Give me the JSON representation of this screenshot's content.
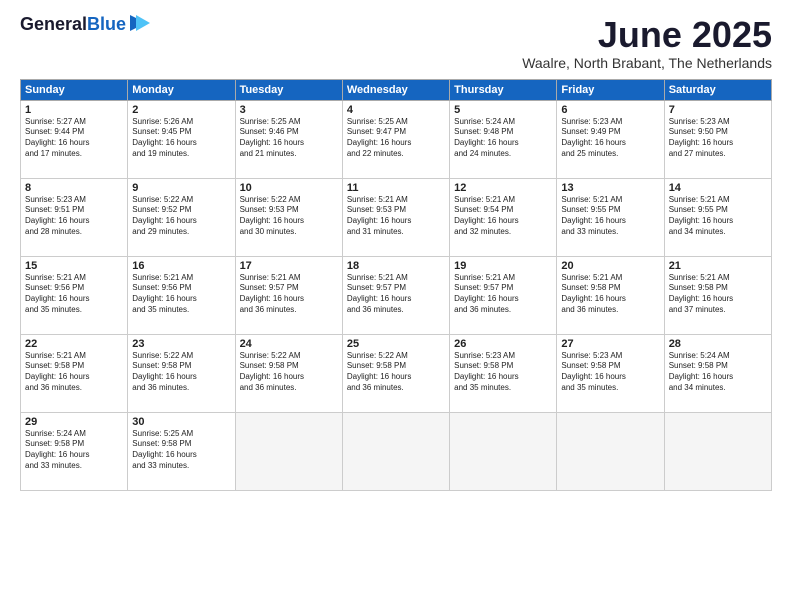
{
  "logo": {
    "line1": "General",
    "line2": "Blue"
  },
  "title": "June 2025",
  "subtitle": "Waalre, North Brabant, The Netherlands",
  "days_of_week": [
    "Sunday",
    "Monday",
    "Tuesday",
    "Wednesday",
    "Thursday",
    "Friday",
    "Saturday"
  ],
  "weeks": [
    [
      {
        "day": 1,
        "lines": [
          "Sunrise: 5:27 AM",
          "Sunset: 9:44 PM",
          "Daylight: 16 hours",
          "and 17 minutes."
        ]
      },
      {
        "day": 2,
        "lines": [
          "Sunrise: 5:26 AM",
          "Sunset: 9:45 PM",
          "Daylight: 16 hours",
          "and 19 minutes."
        ]
      },
      {
        "day": 3,
        "lines": [
          "Sunrise: 5:25 AM",
          "Sunset: 9:46 PM",
          "Daylight: 16 hours",
          "and 21 minutes."
        ]
      },
      {
        "day": 4,
        "lines": [
          "Sunrise: 5:25 AM",
          "Sunset: 9:47 PM",
          "Daylight: 16 hours",
          "and 22 minutes."
        ]
      },
      {
        "day": 5,
        "lines": [
          "Sunrise: 5:24 AM",
          "Sunset: 9:48 PM",
          "Daylight: 16 hours",
          "and 24 minutes."
        ]
      },
      {
        "day": 6,
        "lines": [
          "Sunrise: 5:23 AM",
          "Sunset: 9:49 PM",
          "Daylight: 16 hours",
          "and 25 minutes."
        ]
      },
      {
        "day": 7,
        "lines": [
          "Sunrise: 5:23 AM",
          "Sunset: 9:50 PM",
          "Daylight: 16 hours",
          "and 27 minutes."
        ]
      }
    ],
    [
      {
        "day": 8,
        "lines": [
          "Sunrise: 5:23 AM",
          "Sunset: 9:51 PM",
          "Daylight: 16 hours",
          "and 28 minutes."
        ]
      },
      {
        "day": 9,
        "lines": [
          "Sunrise: 5:22 AM",
          "Sunset: 9:52 PM",
          "Daylight: 16 hours",
          "and 29 minutes."
        ]
      },
      {
        "day": 10,
        "lines": [
          "Sunrise: 5:22 AM",
          "Sunset: 9:53 PM",
          "Daylight: 16 hours",
          "and 30 minutes."
        ]
      },
      {
        "day": 11,
        "lines": [
          "Sunrise: 5:21 AM",
          "Sunset: 9:53 PM",
          "Daylight: 16 hours",
          "and 31 minutes."
        ]
      },
      {
        "day": 12,
        "lines": [
          "Sunrise: 5:21 AM",
          "Sunset: 9:54 PM",
          "Daylight: 16 hours",
          "and 32 minutes."
        ]
      },
      {
        "day": 13,
        "lines": [
          "Sunrise: 5:21 AM",
          "Sunset: 9:55 PM",
          "Daylight: 16 hours",
          "and 33 minutes."
        ]
      },
      {
        "day": 14,
        "lines": [
          "Sunrise: 5:21 AM",
          "Sunset: 9:55 PM",
          "Daylight: 16 hours",
          "and 34 minutes."
        ]
      }
    ],
    [
      {
        "day": 15,
        "lines": [
          "Sunrise: 5:21 AM",
          "Sunset: 9:56 PM",
          "Daylight: 16 hours",
          "and 35 minutes."
        ]
      },
      {
        "day": 16,
        "lines": [
          "Sunrise: 5:21 AM",
          "Sunset: 9:56 PM",
          "Daylight: 16 hours",
          "and 35 minutes."
        ]
      },
      {
        "day": 17,
        "lines": [
          "Sunrise: 5:21 AM",
          "Sunset: 9:57 PM",
          "Daylight: 16 hours",
          "and 36 minutes."
        ]
      },
      {
        "day": 18,
        "lines": [
          "Sunrise: 5:21 AM",
          "Sunset: 9:57 PM",
          "Daylight: 16 hours",
          "and 36 minutes."
        ]
      },
      {
        "day": 19,
        "lines": [
          "Sunrise: 5:21 AM",
          "Sunset: 9:57 PM",
          "Daylight: 16 hours",
          "and 36 minutes."
        ]
      },
      {
        "day": 20,
        "lines": [
          "Sunrise: 5:21 AM",
          "Sunset: 9:58 PM",
          "Daylight: 16 hours",
          "and 36 minutes."
        ]
      },
      {
        "day": 21,
        "lines": [
          "Sunrise: 5:21 AM",
          "Sunset: 9:58 PM",
          "Daylight: 16 hours",
          "and 37 minutes."
        ]
      }
    ],
    [
      {
        "day": 22,
        "lines": [
          "Sunrise: 5:21 AM",
          "Sunset: 9:58 PM",
          "Daylight: 16 hours",
          "and 36 minutes."
        ]
      },
      {
        "day": 23,
        "lines": [
          "Sunrise: 5:22 AM",
          "Sunset: 9:58 PM",
          "Daylight: 16 hours",
          "and 36 minutes."
        ]
      },
      {
        "day": 24,
        "lines": [
          "Sunrise: 5:22 AM",
          "Sunset: 9:58 PM",
          "Daylight: 16 hours",
          "and 36 minutes."
        ]
      },
      {
        "day": 25,
        "lines": [
          "Sunrise: 5:22 AM",
          "Sunset: 9:58 PM",
          "Daylight: 16 hours",
          "and 36 minutes."
        ]
      },
      {
        "day": 26,
        "lines": [
          "Sunrise: 5:23 AM",
          "Sunset: 9:58 PM",
          "Daylight: 16 hours",
          "and 35 minutes."
        ]
      },
      {
        "day": 27,
        "lines": [
          "Sunrise: 5:23 AM",
          "Sunset: 9:58 PM",
          "Daylight: 16 hours",
          "and 35 minutes."
        ]
      },
      {
        "day": 28,
        "lines": [
          "Sunrise: 5:24 AM",
          "Sunset: 9:58 PM",
          "Daylight: 16 hours",
          "and 34 minutes."
        ]
      }
    ],
    [
      {
        "day": 29,
        "lines": [
          "Sunrise: 5:24 AM",
          "Sunset: 9:58 PM",
          "Daylight: 16 hours",
          "and 33 minutes."
        ]
      },
      {
        "day": 30,
        "lines": [
          "Sunrise: 5:25 AM",
          "Sunset: 9:58 PM",
          "Daylight: 16 hours",
          "and 33 minutes."
        ]
      },
      {
        "day": null,
        "lines": []
      },
      {
        "day": null,
        "lines": []
      },
      {
        "day": null,
        "lines": []
      },
      {
        "day": null,
        "lines": []
      },
      {
        "day": null,
        "lines": []
      }
    ]
  ]
}
